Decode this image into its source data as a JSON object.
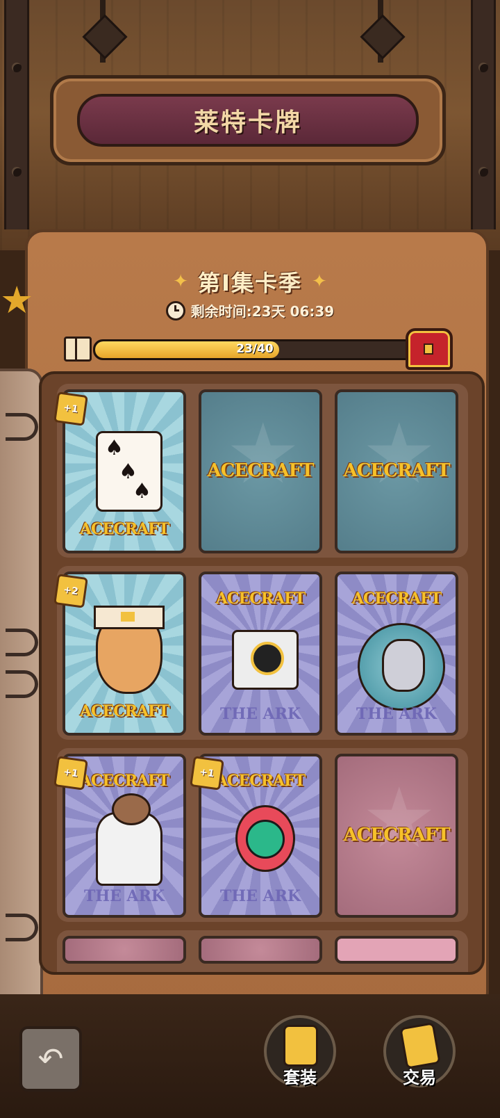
{
  "header": {
    "title": "莱特卡牌"
  },
  "season": {
    "title": "第I集卡季",
    "timer_label": "剩余时间:23天 06:39"
  },
  "progress": {
    "current": 23,
    "total": 40,
    "label": "23/40"
  },
  "cards": [
    {
      "row": 1,
      "col": 1,
      "face": "spade",
      "style": "teal",
      "logo": "ACECRAFT",
      "badge": "+1"
    },
    {
      "row": 1,
      "col": 2,
      "face": "back",
      "style": "back-teal",
      "logo": "ACECRAFT"
    },
    {
      "row": 1,
      "col": 3,
      "face": "back",
      "style": "back-teal",
      "logo": "ACECRAFT"
    },
    {
      "row": 2,
      "col": 1,
      "face": "king",
      "style": "teal",
      "logo": "ACECRAFT",
      "badge": "+2"
    },
    {
      "row": 2,
      "col": 2,
      "face": "camera",
      "style": "purple",
      "logo": "ACECRAFT",
      "footer": "THE ARK"
    },
    {
      "row": 2,
      "col": 3,
      "face": "rat",
      "style": "purple",
      "logo": "ACECRAFT",
      "footer": "THE ARK"
    },
    {
      "row": 3,
      "col": 1,
      "face": "scientist",
      "style": "purple",
      "logo": "ACECRAFT",
      "footer": "THE ARK",
      "badge": "+1"
    },
    {
      "row": 3,
      "col": 2,
      "face": "robot",
      "style": "purple",
      "logo": "ACECRAFT",
      "footer": "THE ARK",
      "badge": "+1"
    },
    {
      "row": 3,
      "col": 3,
      "face": "back",
      "style": "back-pink",
      "logo": "ACECRAFT"
    }
  ],
  "bottom_nav": {
    "back_icon": "undo-arrow-icon",
    "set_label": "套装",
    "trade_label": "交易"
  },
  "colors": {
    "progress_fill": "#f2c13f",
    "title_panel": "#6b2f40",
    "badge": "#f2c13f"
  }
}
